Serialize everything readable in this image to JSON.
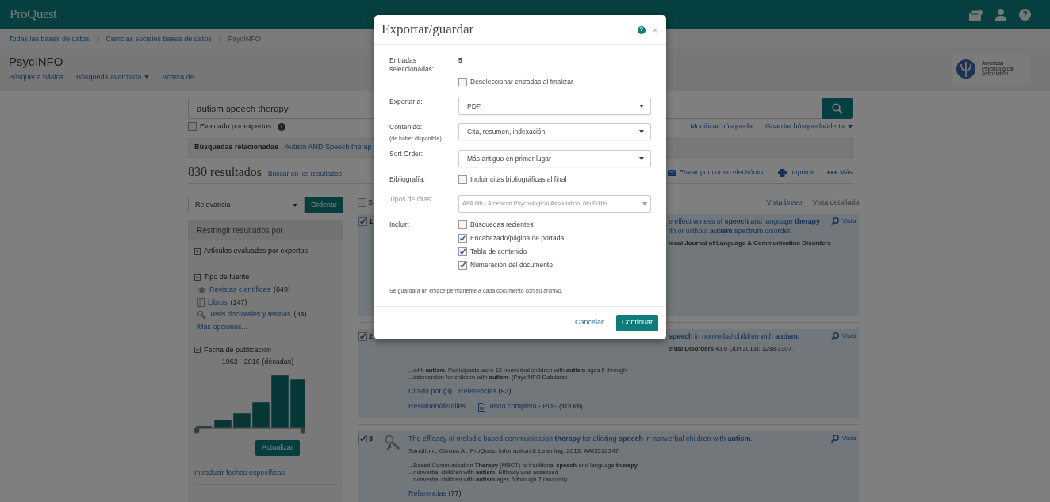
{
  "header": {
    "logo": "ProQuest",
    "help_icon": "?"
  },
  "breadcrumbs": [
    {
      "label": "Todas las bases de datos",
      "link": true
    },
    {
      "label": "Ciencias sociales bases de datos",
      "link": true
    },
    {
      "label": "PsycINFO",
      "link": false
    }
  ],
  "database": {
    "title": "PsycINFO",
    "nav": [
      {
        "label": "Búsqueda básica",
        "dropdown": false
      },
      {
        "label": "Búsqueda avanzada",
        "dropdown": true
      },
      {
        "label": "Acerca de",
        "dropdown": false
      }
    ],
    "publisher_logo": [
      "American",
      "Psychological",
      "Association"
    ]
  },
  "search": {
    "value": "autism speech therapy",
    "peer_reviewed": {
      "label": "Evaluado por expertos",
      "checked": false
    },
    "info_icon": "i",
    "links": [
      {
        "label": "Modificar búsqueda",
        "dropdown": false
      },
      {
        "label": "Guardar búsqueda/alerta",
        "dropdown": true
      }
    ]
  },
  "related": {
    "label": "Búsquedas relacionadas",
    "link": "Autism AND Speech therap"
  },
  "results_header": {
    "count": "830 resultados",
    "search_within": "Buscar en los resultados",
    "actions": [
      {
        "kind": "email",
        "label": "Enviar por correo electrónico"
      },
      {
        "kind": "print",
        "label": "Imprimir"
      },
      {
        "kind": "more",
        "label": "Más"
      }
    ]
  },
  "sort": {
    "value": "Relevancia",
    "button": "Ordenar"
  },
  "facets": {
    "title": "Restringir resultados por",
    "groups": [
      {
        "label": "Artículos evaluados por expertos",
        "expanded": false
      },
      {
        "label": "Tipo de fuente",
        "expanded": true,
        "items": [
          {
            "kind": "journal",
            "label": "Revistas científicas",
            "count": "(649)"
          },
          {
            "kind": "book",
            "label": "Libros",
            "count": "(147)"
          },
          {
            "kind": "dissertation",
            "label": "Tesis doctorales y tesinas",
            "count": "(34)"
          }
        ],
        "more": "Más opciones..."
      },
      {
        "label": "Fecha de publicación",
        "expanded": true,
        "range": "1962 - 2016 (décadas)",
        "button": "Actualizar",
        "link": "Introducir fechas específicas"
      }
    ]
  },
  "list": {
    "select_all": {
      "label": "S",
      "checked": false
    },
    "views": [
      {
        "label": "Vista breve",
        "selected": false
      },
      {
        "label": "Vista detallada",
        "selected": true
      }
    ]
  },
  "results": [
    {
      "number": "1",
      "checked": true,
      "view": "Vista",
      "title": [
        "e effectiveness of **speech** and language **therapy**",
        "ith or without **autism** spectrum disorder."
      ],
      "source": "**ional Journal of Language & Communication Disorders**"
    },
    {
      "number": "2",
      "checked": true,
      "view": "Vista",
      "title": [
        "**speech** in nonverbal children with **autism**."
      ],
      "source": "**ental Disorders** 43.6 (Jun 2013): 1298-1307.",
      "snippets": [
        "...with **autism**. Participants were 12 nonverbal children with **autism** ages 5 through",
        "...intervention for children with **autism**. (PsycINFO Database"
      ],
      "links": [
        {
          "label": "Citado por",
          "count": "(3)"
        },
        {
          "label": "Referencias",
          "count": "(93)"
        }
      ],
      "actions": [
        {
          "kind": "details",
          "label": "Resumen/detalles"
        },
        {
          "kind": "pdf",
          "label": "Texto completo - PDF",
          "size": "(313 KB)"
        }
      ]
    },
    {
      "number": "3",
      "checked": true,
      "view": "Vista",
      "title": [
        "The efficacy of melodic based communication **therapy** for eliciting **speech** in nonverbal children with **autism**."
      ],
      "source": "Sandiford, Givona A.. ProQuest Information & Learning, 2013. AAI3512347.",
      "snippets": [
        "...Based Communication **Therapy** (MBCT) to traditional **speech** and language **therapy**",
        "...nonverbal children with **autism**. Efficacy was assessed",
        "...nonverbal children with **autism** ages 5 through 7 randomly"
      ],
      "links": [
        {
          "label": "Referencias",
          "count": "(77)"
        }
      ]
    }
  ],
  "modal": {
    "title": "Exportar/guardar",
    "help_icon": "?",
    "close": "×",
    "rows": [
      {
        "kind": "count",
        "label": "Entradas seleccionadas:",
        "value": "5",
        "options": [
          {
            "label": "Deseleccionar entradas al finalizar",
            "checked": false
          }
        ]
      },
      {
        "kind": "select",
        "label": "Exportar a:",
        "value": "PDF",
        "disabled": false
      },
      {
        "kind": "select",
        "label": "Contenido:",
        "note": "(de haber disponible)",
        "value": "Cita, resumen, indexación",
        "disabled": false
      },
      {
        "kind": "select",
        "label": "Sort Order:",
        "value": "Más antiguo en primer lugar",
        "disabled": false
      },
      {
        "kind": "checks",
        "label": "Bibliografía:",
        "options": [
          {
            "label": "Incluir citas bibliográficas al final",
            "checked": false
          }
        ]
      },
      {
        "kind": "select",
        "label": "Tipos de citas:",
        "value": "APA 6th - American Psychological Association, 6th Editio",
        "disabled": true
      },
      {
        "kind": "checks",
        "label": "Incluir:",
        "options": [
          {
            "label": "Búsquedas recientes",
            "checked": false
          },
          {
            "label": "Encabezado/página de portada",
            "checked": true
          },
          {
            "label": "Tabla de contenido",
            "checked": true
          },
          {
            "label": "Numeración del documento",
            "checked": true
          }
        ]
      }
    ],
    "note": "Se guardará un enlace permanente a cada documento con su archivo.",
    "cancel": "Cancelar",
    "submit": "Continuar"
  }
}
